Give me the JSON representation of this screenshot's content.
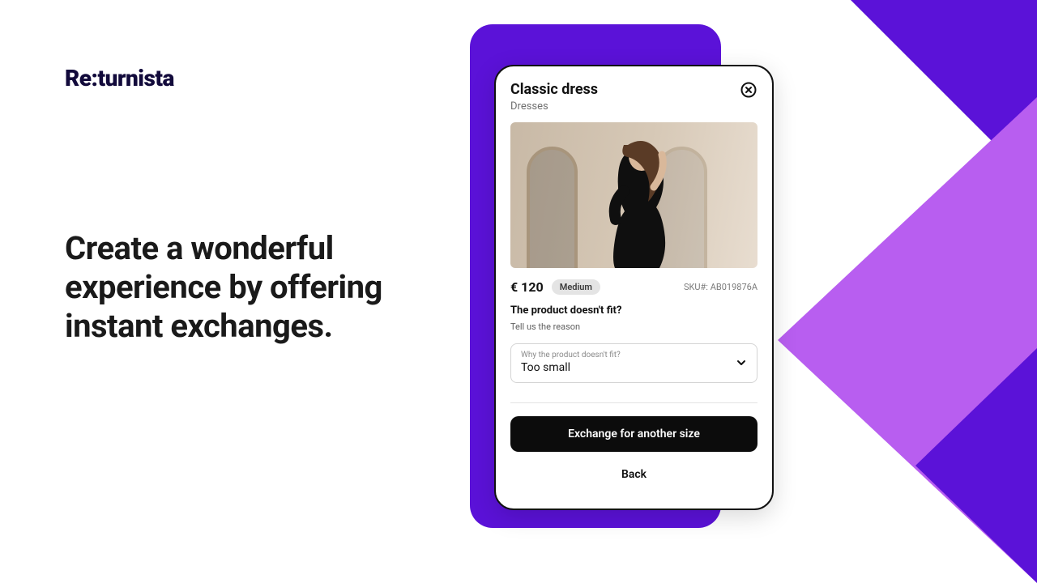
{
  "branding": {
    "logo_prefix": "Re",
    "logo_colon": ":",
    "logo_suffix": "turnista"
  },
  "marketing": {
    "headline": "Create a wonderful experience by offering instant exchanges."
  },
  "product_modal": {
    "title": "Classic dress",
    "category": "Dresses",
    "price": "€ 120",
    "size_label": "Medium",
    "sku_label": "SKU#: AB019876A",
    "fit_question": "The product doesn't fit?",
    "fit_subtext": "Tell us the reason",
    "reason_select": {
      "label": "Why the product doesn't fit?",
      "value": "Too small"
    },
    "primary_cta": "Exchange for another size",
    "secondary_cta": "Back"
  }
}
